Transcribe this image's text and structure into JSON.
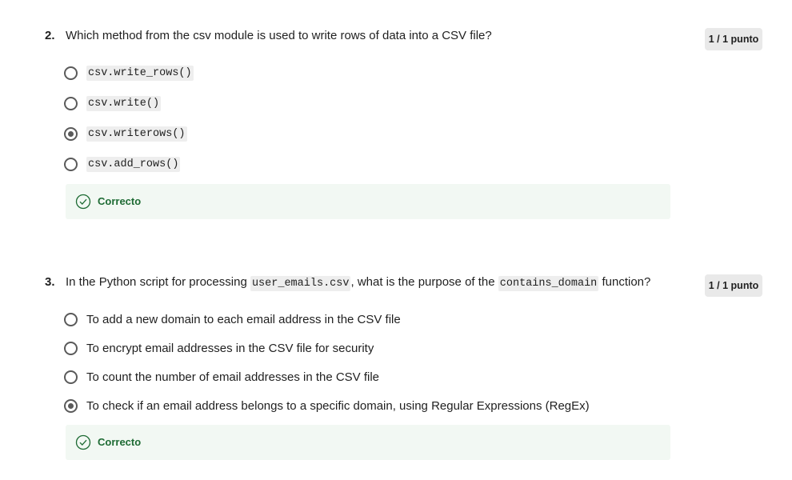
{
  "questions": [
    {
      "number": "2.",
      "text": "Which method from the csv module is used to write rows of data into a CSV file?",
      "points": "1 / 1 punto",
      "options": [
        {
          "label": "csv.write_rows()",
          "selected": false
        },
        {
          "label": "csv.write()",
          "selected": false
        },
        {
          "label": "csv.writerows()",
          "selected": true
        },
        {
          "label": "csv.add_rows()",
          "selected": false
        }
      ],
      "feedback": "Correcto"
    },
    {
      "number": "3.",
      "text_parts": {
        "part1": "In the Python script for processing ",
        "code1": "user_emails.csv",
        "part2": ", what is the purpose of the ",
        "code2": "contains_domain",
        "part3": " function?"
      },
      "points": "1 / 1 punto",
      "options": [
        {
          "label": "To add a new domain to each email address in the CSV file",
          "selected": false
        },
        {
          "label": "To encrypt email addresses in the CSV file for security",
          "selected": false
        },
        {
          "label": "To count the number of email addresses in the CSV file",
          "selected": false
        },
        {
          "label": "To check if an email address belongs to a specific domain, using Regular Expressions (RegEx)",
          "selected": true
        }
      ],
      "feedback": "Correcto"
    }
  ],
  "colors": {
    "correct_green": "#1e6b34",
    "feedback_bg": "#f2f8f3",
    "points_bg": "#e9e9e9",
    "radio": "#5a5a5a"
  }
}
